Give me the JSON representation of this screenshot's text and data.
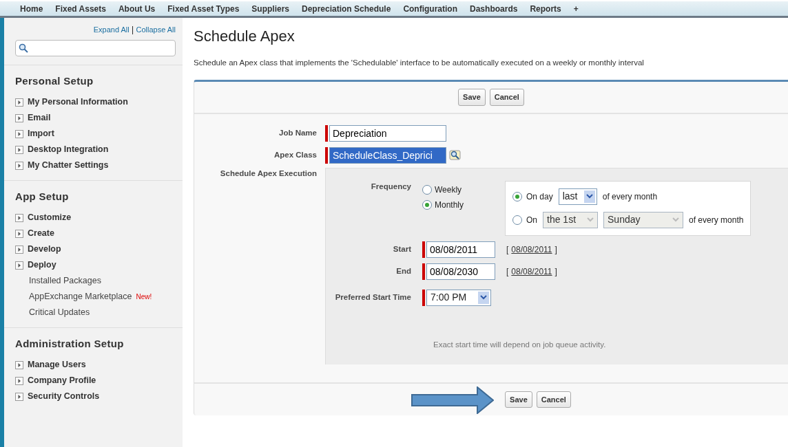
{
  "tabs": [
    {
      "label": "Home"
    },
    {
      "label": "Fixed Assets"
    },
    {
      "label": "About Us"
    },
    {
      "label": "Fixed Asset Types"
    },
    {
      "label": "Suppliers"
    },
    {
      "label": "Depreciation Schedule"
    },
    {
      "label": "Configuration"
    },
    {
      "label": "Dashboards"
    },
    {
      "label": "Reports"
    },
    {
      "label": "+"
    }
  ],
  "sidebar": {
    "expand_all": "Expand All",
    "separator": "|",
    "collapse_all": "Collapse All",
    "sections": [
      {
        "title": "Personal Setup",
        "items": [
          {
            "label": "My Personal Information",
            "kind": "expandable"
          },
          {
            "label": "Email",
            "kind": "expandable"
          },
          {
            "label": "Import",
            "kind": "expandable"
          },
          {
            "label": "Desktop Integration",
            "kind": "expandable"
          },
          {
            "label": "My Chatter Settings",
            "kind": "expandable"
          }
        ]
      },
      {
        "title": "App Setup",
        "items": [
          {
            "label": "Customize",
            "kind": "expandable"
          },
          {
            "label": "Create",
            "kind": "expandable"
          },
          {
            "label": "Develop",
            "kind": "expandable"
          },
          {
            "label": "Deploy",
            "kind": "expandable"
          },
          {
            "label": "Installed Packages",
            "kind": "link"
          },
          {
            "label": "AppExchange Marketplace",
            "kind": "link",
            "badge": "New!"
          },
          {
            "label": "Critical Updates",
            "kind": "link"
          }
        ]
      },
      {
        "title": "Administration Setup",
        "items": [
          {
            "label": "Manage Users",
            "kind": "expandable"
          },
          {
            "label": "Company Profile",
            "kind": "expandable"
          },
          {
            "label": "Security Controls",
            "kind": "expandable"
          }
        ]
      }
    ]
  },
  "page": {
    "title": "Schedule Apex",
    "description": "Schedule an Apex class that implements the 'Schedulable' interface to be automatically executed on a weekly or monthly interval"
  },
  "buttons": [
    "Save",
    "Cancel"
  ],
  "form": {
    "job_name": {
      "label": "Job Name",
      "value": "Depreciation"
    },
    "apex_class": {
      "label": "Apex Class",
      "value": "ScheduleClass_Deprici"
    },
    "execution_label": "Schedule Apex Execution",
    "frequency": {
      "label": "Frequency",
      "options": [
        {
          "label": "Weekly",
          "selected": false
        },
        {
          "label": "Monthly",
          "selected": true
        }
      ]
    },
    "monthly": [
      {
        "prefix": "On day",
        "selects": [
          {
            "value": "last",
            "disabled": false
          }
        ],
        "suffix": "of every month",
        "selected": true
      },
      {
        "prefix": "On",
        "selects": [
          {
            "value": "the 1st",
            "disabled": true
          },
          {
            "value": "Sunday",
            "disabled": true
          }
        ],
        "suffix": "of every month",
        "selected": false
      }
    ],
    "start": {
      "label": "Start",
      "value": "08/08/2011",
      "open": "[",
      "today": "08/08/2011",
      "close": "]"
    },
    "end": {
      "label": "End",
      "value": "08/08/2030",
      "open": "[",
      "today": "08/08/2011",
      "close": "]"
    },
    "start_time": {
      "label": "Preferred Start Time",
      "value": "7:00 PM"
    },
    "hint": "Exact start time will depend on job queue activity."
  },
  "bottom_buttons": [
    "Save",
    "Cancel"
  ]
}
